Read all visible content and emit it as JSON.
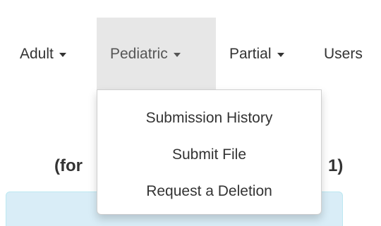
{
  "navbar": {
    "items": [
      {
        "label": "Adult",
        "has_caret": true
      },
      {
        "label": "Pediatric",
        "has_caret": true,
        "active": true
      },
      {
        "label": "Partial",
        "has_caret": true
      },
      {
        "label": "Users",
        "has_caret": false
      }
    ]
  },
  "dropdown": {
    "items": [
      {
        "label": "Submission History"
      },
      {
        "label": "Submit File"
      },
      {
        "label": "Request a Deletion"
      }
    ]
  },
  "heading": {
    "left_fragment": "(for",
    "right_fragment": "1)"
  },
  "colors": {
    "active_nav_bg": "#e7e7e7",
    "text": "#333333",
    "alert_bg": "#d9edf7",
    "alert_border": "#bce8f1"
  },
  "icons": {
    "caret": "caret-down-icon"
  }
}
